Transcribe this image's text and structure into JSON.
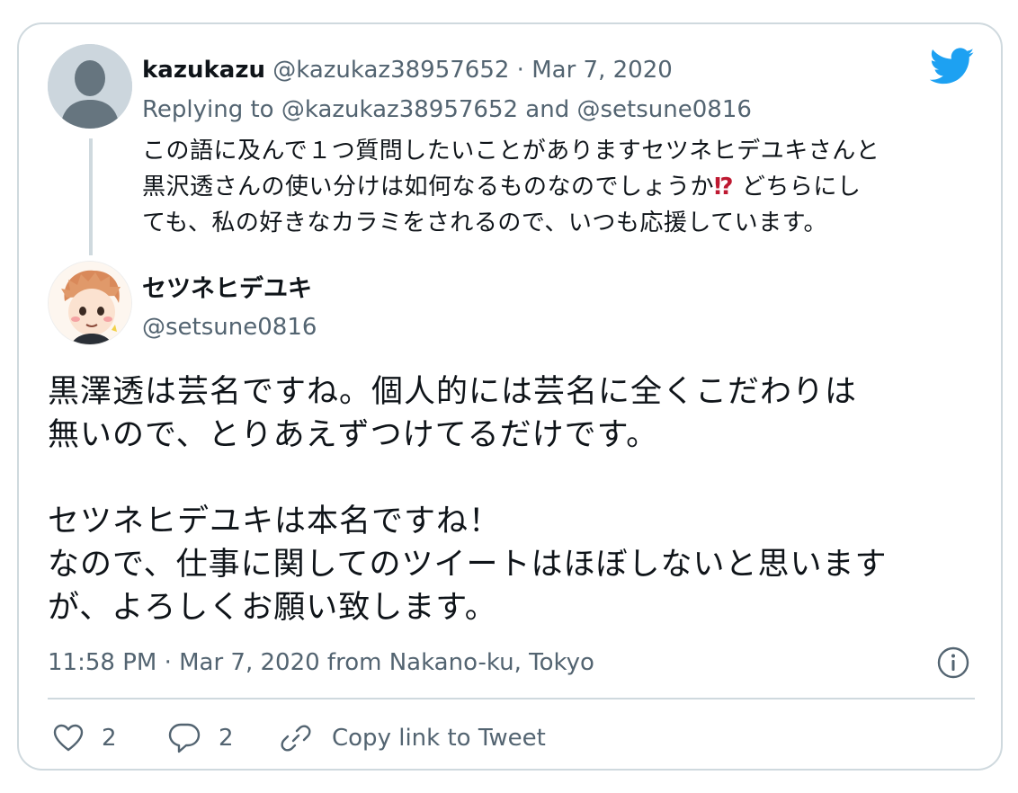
{
  "parent_tweet": {
    "display_name": "kazukazu",
    "handle": "@kazukaz38957652",
    "separator": " · ",
    "date": "Mar 7, 2020",
    "replying_prefix": "Replying to ",
    "replying_user1": "@kazukaz38957652",
    "replying_and": " and ",
    "replying_user2": "@setsune0816",
    "text_line1": "この語に及んで１つ質問したいことがありますセツネヒデユキさんと",
    "text_line2a": "黒沢透さんの使い分けは如何なるものなのでしょうか",
    "text_line2_emoji": "⁉",
    "text_line2b": " どちらにし",
    "text_line3": "ても、私の好きなカラミをされるので、いつも応援しています。"
  },
  "main_tweet": {
    "display_name": "セツネヒデユキ",
    "handle": "@setsune0816",
    "text_lines": [
      "黒澤透は芸名ですね。個人的には芸名に全くこだわりは",
      "無いので、とりあえずつけてるだけです。",
      "",
      "セツネヒデユキは本名ですね！",
      "なので、仕事に関してのツイートはほぼしないと思います",
      "が、よろしくお願い致します。"
    ],
    "timestamp": "11:58 PM · Mar 7, 2020 from Nakano-ku, Tokyo"
  },
  "actions": {
    "like_count": "2",
    "reply_count": "2",
    "copy_link_label": "Copy link to Tweet"
  },
  "icons": {
    "brand": "twitter-bird-icon",
    "info": "info-icon",
    "like": "heart-icon",
    "reply": "reply-bubble-icon",
    "link": "link-icon"
  },
  "colors": {
    "twitter_blue": "#1da1f2",
    "muted_text": "#536471",
    "border": "#cfd9de",
    "interrobang": "#be1931"
  }
}
